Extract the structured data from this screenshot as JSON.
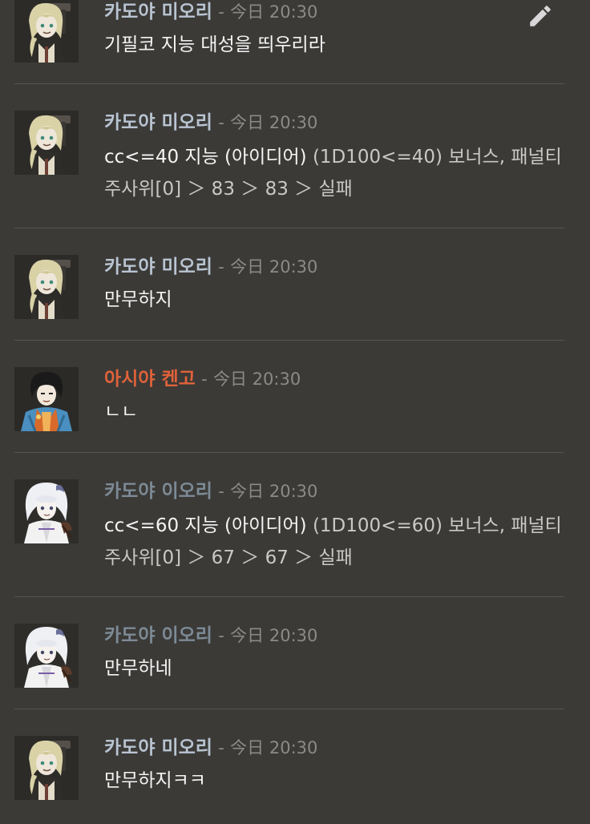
{
  "colors": {
    "background": "#3b3a37",
    "name_miori": "#b9c4d2",
    "name_kengo": "#e0623a",
    "name_iori": "#7d8a96",
    "timestamp": "#8a8a86",
    "divider": "#55544f"
  },
  "messages": [
    {
      "speaker": "카도야 미오리",
      "separator": "-",
      "timestamp": "今日 20:30",
      "text": "기필코 지능 대성을 띄우리라",
      "avatar_icon": "miori-avatar-icon"
    },
    {
      "speaker": "카도야 미오리",
      "separator": "-",
      "timestamp": "今日 20:30",
      "roll_command": "cc<=40 지능 (아이디어)",
      "roll_detail": "(1D100<=40) 보너스, 패널티 주사위[0] ＞ 83 ＞ 83 ＞ 실패",
      "avatar_icon": "miori-avatar-icon"
    },
    {
      "speaker": "카도야 미오리",
      "separator": "-",
      "timestamp": "今日 20:30",
      "text": "만무하지",
      "avatar_icon": "miori-avatar-icon"
    },
    {
      "speaker": "아시야 켄고",
      "separator": "-",
      "timestamp": "今日 20:30",
      "text": "ㄴㄴ",
      "avatar_icon": "kengo-avatar-icon"
    },
    {
      "speaker": "카도야 이오리",
      "separator": "-",
      "timestamp": "今日 20:30",
      "roll_command": "cc<=60 지능 (아이디어)",
      "roll_detail": "(1D100<=60) 보너스, 패널티 주사위[0] ＞ 67 ＞ 67 ＞ 실패",
      "avatar_icon": "iori-avatar-icon"
    },
    {
      "speaker": "카도야 이오리",
      "separator": "-",
      "timestamp": "今日 20:30",
      "text": "만무하네",
      "avatar_icon": "iori-avatar-icon"
    },
    {
      "speaker": "카도야 미오리",
      "separator": "-",
      "timestamp": "今日 20:30",
      "text": "만무하지ㅋㅋ",
      "avatar_icon": "miori-avatar-icon"
    }
  ],
  "edit_icon": "pencil-icon"
}
